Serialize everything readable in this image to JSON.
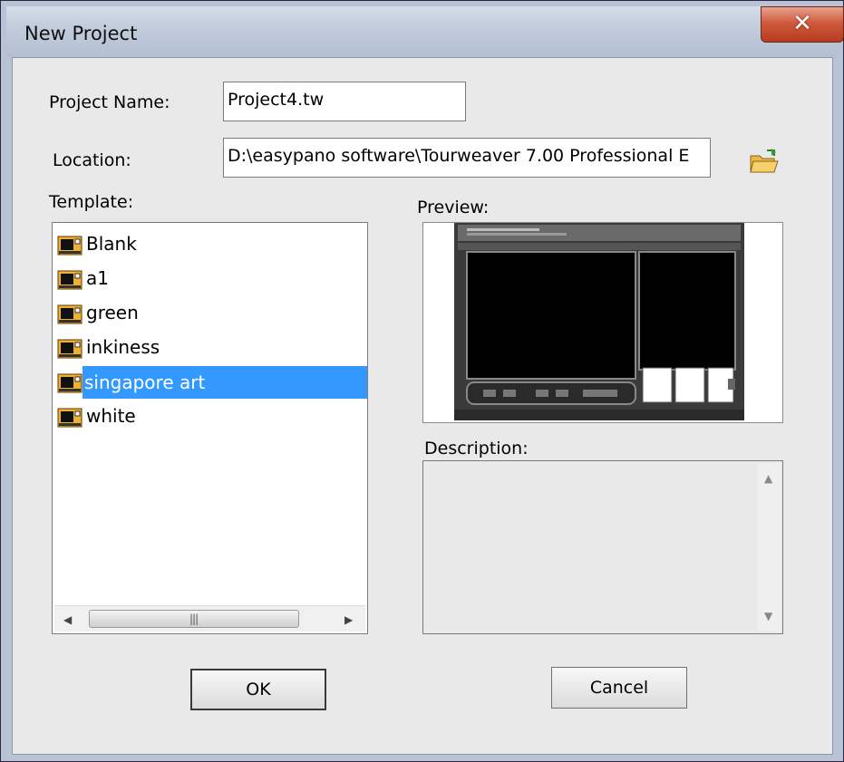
{
  "window": {
    "title": "New Project",
    "close_symbol": "✕"
  },
  "form": {
    "project_name_label": "Project Name:",
    "project_name_value": "Project4.tw",
    "location_label": "Location:",
    "location_value": "D:\\easypano software\\Tourweaver 7.00 Professional E",
    "template_label": "Template:",
    "preview_label": "Preview:",
    "description_label": "Description:"
  },
  "templates": {
    "items": [
      {
        "label": "Blank",
        "selected": false
      },
      {
        "label": "a1",
        "selected": false
      },
      {
        "label": "green",
        "selected": false
      },
      {
        "label": "inkiness",
        "selected": false
      },
      {
        "label": "singapore art",
        "selected": true
      },
      {
        "label": "white",
        "selected": false
      }
    ],
    "icon": "template-film-icon"
  },
  "scrollbar": {
    "left_arrow": "◀",
    "right_arrow": "▶",
    "grip": "|||",
    "up_arrow": "▲",
    "down_arrow": "▼"
  },
  "buttons": {
    "ok_label": "OK",
    "cancel_label": "Cancel"
  },
  "colors": {
    "selection": "#3399ff",
    "close_button": "#c94a2e"
  }
}
